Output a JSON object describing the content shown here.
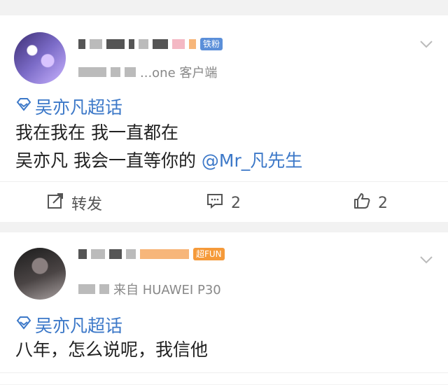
{
  "posts": [
    {
      "source_text": "...one 客户端",
      "badges": [
        "铁粉"
      ],
      "topic": "吴亦凡超话",
      "lines": [
        "我在我在 我一直都在",
        "吴亦凡 我会一直等你的"
      ],
      "mention": "@Mr_凡先生",
      "actions": {
        "repost": "转发",
        "comments": "2",
        "likes": "2"
      }
    },
    {
      "source_text": "来自 HUAWEI P30",
      "badges": [
        "超FUN"
      ],
      "topic": "吴亦凡超话",
      "lines": [
        "八年，怎么说呢，我信他"
      ]
    }
  ],
  "colors": {
    "link": "#3c78c8",
    "badge_blue": "#5b8fd9",
    "badge_orange": "#f59a3a"
  },
  "icons": [
    "chevron-down-icon",
    "topic-diamond-icon",
    "repost-icon",
    "comment-icon",
    "like-icon"
  ]
}
